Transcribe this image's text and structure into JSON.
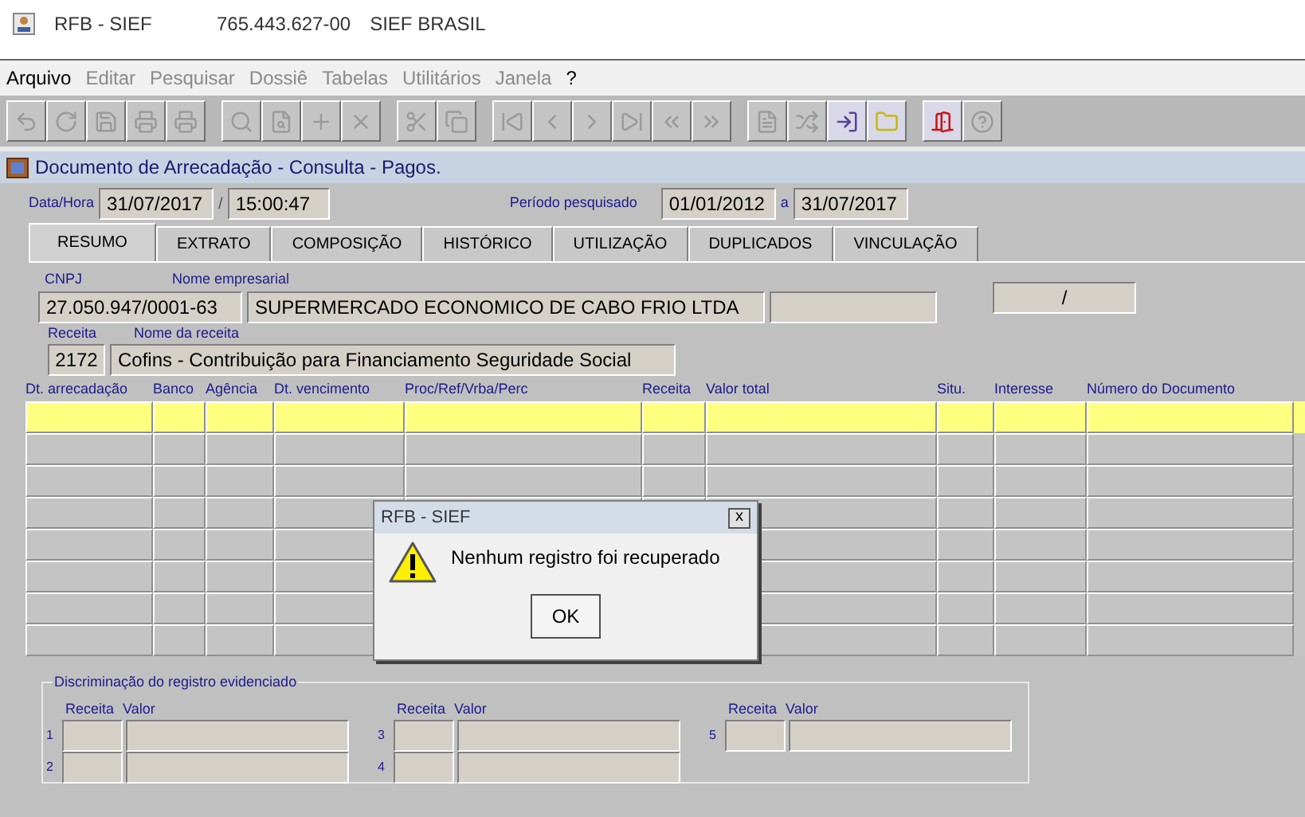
{
  "window": {
    "title": "RFB - SIEF",
    "user_id": "765.443.627-00",
    "system": "SIEF BRASIL"
  },
  "menu": [
    {
      "label": "Arquivo",
      "disabled": false
    },
    {
      "label": "Editar",
      "disabled": true
    },
    {
      "label": "Pesquisar",
      "disabled": true
    },
    {
      "label": "Dossiê",
      "disabled": true
    },
    {
      "label": "Tabelas",
      "disabled": true
    },
    {
      "label": "Utilitários",
      "disabled": true
    },
    {
      "label": "Janela",
      "disabled": true
    },
    {
      "label": "?",
      "disabled": false
    }
  ],
  "toolbar": [
    [
      {
        "disabled": true
      },
      {
        "disabled": true
      },
      {
        "disabled": true
      },
      {
        "disabled": true
      },
      {
        "disabled": true
      }
    ],
    [
      {
        "disabled": true
      },
      {
        "disabled": true
      },
      {
        "disabled": true
      },
      {
        "disabled": true
      }
    ],
    [
      {
        "disabled": true
      },
      {
        "disabled": true
      }
    ],
    [
      {
        "disabled": true
      },
      {
        "disabled": true
      },
      {
        "disabled": true
      },
      {
        "disabled": true
      },
      {
        "disabled": true
      },
      {
        "disabled": true
      }
    ],
    [
      {
        "disabled": true
      },
      {
        "disabled": true
      },
      {
        "disabled": false
      },
      {
        "disabled": false
      }
    ],
    [
      {
        "disabled": false
      },
      {
        "disabled": true
      }
    ]
  ],
  "form": {
    "title": "Documento de Arrecadação - Consulta - Pagos.",
    "datetime_label": "Data/Hora",
    "date": "31/07/2017",
    "separator": "/",
    "time": "15:00:47",
    "period_label": "Período pesquisado",
    "period_start": "01/01/2012",
    "period_join": "a",
    "period_end": "31/07/2017"
  },
  "tabs": [
    {
      "label": "RESUMO",
      "selected": true
    },
    {
      "label": "EXTRATO",
      "selected": false
    },
    {
      "label": "COMPOSIÇÃO",
      "selected": false
    },
    {
      "label": "HISTÓRICO",
      "selected": false
    },
    {
      "label": "UTILIZAÇÃO",
      "selected": false
    },
    {
      "label": "DUPLICADOS",
      "selected": false
    },
    {
      "label": "VINCULAÇÃO",
      "selected": false
    }
  ],
  "summary": {
    "cnpj_label": "CNPJ",
    "cnpj": "27.050.947/0001-63",
    "name_label": "Nome empresarial",
    "name": "SUPERMERCADO ECONOMICO DE CABO FRIO LTDA",
    "side_value": "/",
    "receita_label": "Receita",
    "receita": "2172",
    "receita_name_label": "Nome da receita",
    "receita_name": "Cofins - Contribuição para Financiamento Seguridade Social"
  },
  "table": {
    "columns": [
      "Dt. arrecadação",
      "Banco",
      "Agência",
      "Dt. vencimento",
      "Proc/Ref/Vrba/Perc",
      "Receita",
      "Valor total",
      "Situ.",
      "Interesse",
      "Número do Documento"
    ],
    "rows": [
      {
        "selected": true
      },
      {
        "selected": false
      },
      {
        "selected": false
      },
      {
        "selected": false
      },
      {
        "selected": false
      },
      {
        "selected": false
      },
      {
        "selected": false
      },
      {
        "selected": false
      }
    ]
  },
  "breakdown": {
    "legend": "Discriminação do registro evidenciado",
    "groups": [
      {
        "receita_label": "Receita",
        "valor_label": "Valor",
        "lines": [
          "1",
          "2"
        ]
      },
      {
        "receita_label": "Receita",
        "valor_label": "Valor",
        "lines": [
          "3",
          "4"
        ]
      },
      {
        "receita_label": "Receita",
        "valor_label": "Valor",
        "lines": [
          "5"
        ]
      }
    ]
  },
  "dialog": {
    "title": "RFB - SIEF",
    "close": "x",
    "message": "Nenhum registro foi recuperado",
    "button": "OK"
  }
}
